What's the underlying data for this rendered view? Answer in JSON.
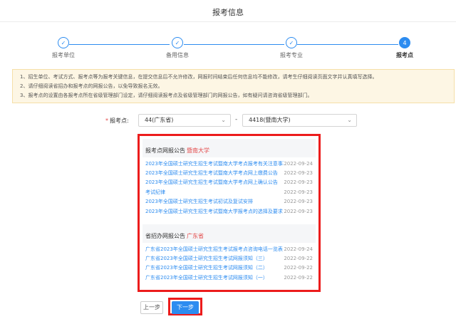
{
  "page": {
    "title": "报考信息"
  },
  "steps": [
    {
      "label": "报考单位",
      "icon": "check-icon",
      "done": true
    },
    {
      "label": "备用信息",
      "icon": "check-icon",
      "done": true
    },
    {
      "label": "报考专业",
      "icon": "check-icon",
      "done": true
    },
    {
      "label": "报考点",
      "number": "4",
      "active": true
    }
  ],
  "notice": [
    "1、招生单位、考试方式、报考点等为报考关键信息，在提交信息后不允许修改，网报时间结束后任何信息均不能修改，请考生仔细阅读页面文字并认真填写选择。",
    "2、请仔细阅读省招办和报考点的网报公告，以免导致报名无效。",
    "3、报考点的设置由各报考点所在省级管理部门设定，请仔细阅读报考点及省级管理部门的网报公告，如有疑问请咨询省级管理部门。"
  ],
  "form": {
    "label": "报考点:",
    "province_value": "44(广东省)",
    "site_value": "4418(暨南大学)",
    "separator": "-"
  },
  "site_notice": {
    "header": "报考点网报公告",
    "region": "暨南大学",
    "items": [
      {
        "title": "2023年全国硕士研究生招生考试暨南大学考点报考有关注意事项",
        "date": "2022-09-24"
      },
      {
        "title": "2023年全国硕士研究生招生考试暨南大学考点网上缴费公告",
        "date": "2022-09-23"
      },
      {
        "title": "2023年全国硕士研究生招生考试暨南大学考点网上确认公告",
        "date": "2022-09-23"
      },
      {
        "title": "考试纪律",
        "date": "2022-09-23"
      },
      {
        "title": "2023年全国硕士研究生招生考试初试及复试安排",
        "date": "2022-09-23"
      },
      {
        "title": "2023年全国硕士研究生招生考试暨南大学报考点的选择及要求",
        "date": "2022-09-23"
      }
    ]
  },
  "province_notice": {
    "header": "省招办网报公告",
    "region": "广东省",
    "items": [
      {
        "title": "广东省2023年全国硕士研究生招生考试报考点咨询电话一览表",
        "date": "2022-09-24"
      },
      {
        "title": "广东省2023年全国硕士研究生招生考试网报须知（三）",
        "date": "2022-09-22"
      },
      {
        "title": "广东省2023年全国硕士研究生招生考试网报须知（二）",
        "date": "2022-09-22"
      },
      {
        "title": "广东省2023年全国硕士研究生招生考试网报须知（一）",
        "date": "2022-09-22"
      }
    ]
  },
  "buttons": {
    "prev": "上一步",
    "next": "下一步"
  },
  "colors": {
    "accent": "#2d8cf0",
    "highlight": "#ec1c1c",
    "notice_bg": "#fdf6e4"
  }
}
